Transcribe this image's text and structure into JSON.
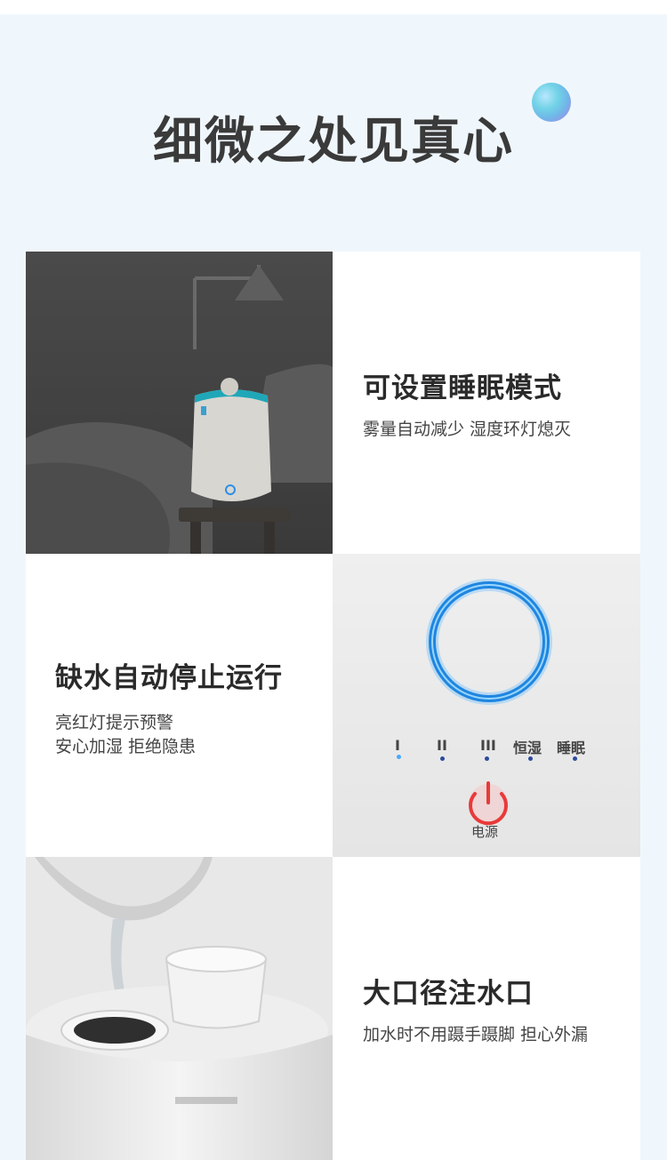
{
  "header": {
    "title": "细微之处见真心"
  },
  "features": [
    {
      "title": "可设置睡眠模式",
      "desc": [
        "雾量自动减少 湿度环灯熄灭"
      ]
    },
    {
      "title": "缺水自动停止运行",
      "desc": [
        "亮红灯提示预警",
        "安心加湿 拒绝隐患"
      ]
    },
    {
      "title": "大口径注水口",
      "desc": [
        "加水时不用蹑手蹑脚  担心外漏"
      ]
    }
  ],
  "control_panel": {
    "levels": [
      "I",
      "II",
      "III"
    ],
    "modes": [
      "恒湿",
      "睡眠"
    ],
    "power_label": "电源",
    "colors": {
      "ring": "#2b8fe8",
      "power": "#e83a3a",
      "dot": "#2b4a9e"
    }
  },
  "colors": {
    "background": "#f0f7fc",
    "title": "#3a3a3a"
  }
}
